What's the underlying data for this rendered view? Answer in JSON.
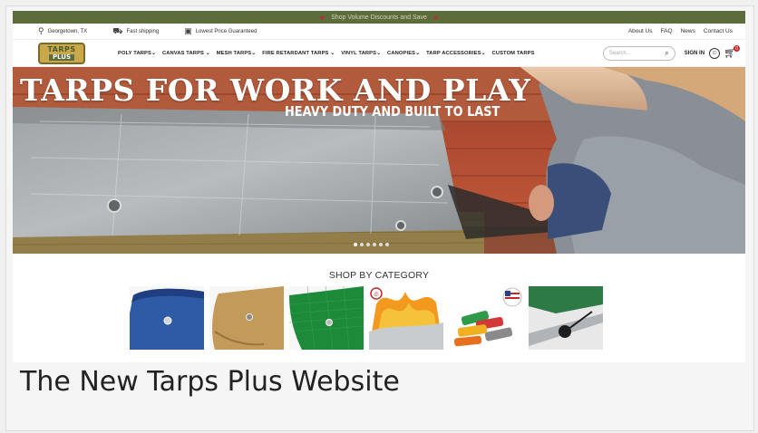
{
  "promo": {
    "text": "Shop Volume Discounts and Save"
  },
  "utility": {
    "location": "Georgetown, TX",
    "shipping": "Fast shipping",
    "price": "Lowest Price Guaranteed",
    "links": [
      "About Us",
      "FAQ",
      "News",
      "Contact Us"
    ]
  },
  "logo": {
    "line1": "TARPS",
    "line2": "PLUS"
  },
  "menu": [
    "POLY TARPS⌄",
    "CANVAS TARPS ⌄",
    "MESH TARPS⌄",
    "FIRE RETARDANT TARPS ⌄",
    "VINYL TARPS⌄",
    "CANOPIES⌄",
    "TARP ACCESSORIES⌄",
    "CUSTOM TARPS"
  ],
  "search": {
    "placeholder": "Search..."
  },
  "account": {
    "signin": "SIGN IN",
    "cart_count": "0"
  },
  "hero": {
    "title": "TARPS FOR WORK AND PLAY",
    "subtitle": "HEAVY DUTY AND BUILT TO LAST",
    "slides": 6,
    "active_slide": 1
  },
  "categories": {
    "title": "SHOP BY CATEGORY",
    "items": [
      "blue-poly",
      "canvas",
      "green-mesh",
      "fire-retardant",
      "vinyl",
      "accessories"
    ]
  },
  "colors": {
    "promo_bg": "#5c6c3a",
    "accent_red": "#c62828",
    "logo_gold": "#c9a84b"
  },
  "caption": "The New Tarps Plus Website"
}
